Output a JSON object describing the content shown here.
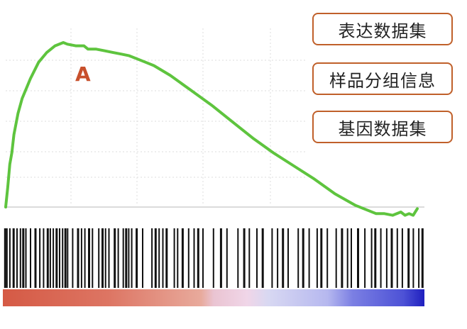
{
  "chart_data": {
    "type": "line",
    "title": "",
    "xlabel": "",
    "ylabel": "",
    "grid": true,
    "annotation": "A",
    "xlim": [
      0,
      100
    ],
    "ylim": [
      -0.05,
      1.0
    ],
    "series": [
      {
        "values_x": [
          0,
          0.5,
          1,
          1.5,
          2,
          3,
          4,
          5,
          6,
          8,
          10,
          12,
          14,
          15,
          17,
          19,
          20,
          22,
          24,
          26,
          28,
          30,
          32,
          34,
          36,
          40,
          45,
          50,
          55,
          60,
          65,
          70,
          75,
          80,
          85,
          90,
          92,
          94,
          96,
          97,
          98,
          99,
          100
        ],
        "values_y": [
          0.0,
          0.12,
          0.26,
          0.33,
          0.44,
          0.57,
          0.66,
          0.72,
          0.78,
          0.88,
          0.94,
          0.98,
          1.0,
          0.99,
          0.98,
          0.98,
          0.96,
          0.96,
          0.95,
          0.94,
          0.93,
          0.92,
          0.9,
          0.88,
          0.86,
          0.8,
          0.71,
          0.62,
          0.52,
          0.42,
          0.33,
          0.25,
          0.17,
          0.08,
          0.01,
          -0.04,
          -0.04,
          -0.05,
          -0.03,
          -0.05,
          -0.04,
          -0.05,
          -0.01
        ]
      }
    ],
    "hits": [
      0.3,
      0.8,
      1.5,
      2.3,
      3.2,
      4.0,
      4.6,
      5.3,
      6.4,
      7.5,
      8.6,
      9.5,
      10.4,
      11.1,
      11.8,
      12.5,
      13.3,
      14.0,
      14.6,
      15.2,
      16.4,
      17.6,
      18.5,
      19.3,
      20.2,
      21.1,
      22.6,
      23.4,
      24.2,
      25.0,
      26.3,
      27.2,
      28.4,
      29.0,
      29.7,
      30.4,
      31.5,
      33.0,
      35.2,
      36.0,
      36.9,
      37.8,
      38.6,
      40.5,
      41.3,
      42.4,
      43.9,
      45.2,
      46.1,
      47.3,
      49.8,
      51.5,
      53.0,
      55.6,
      57.0,
      58.3,
      60.1,
      61.4,
      63.7,
      65.0,
      66.2,
      67.5,
      69.9,
      71.0,
      72.5,
      74.4,
      75.3,
      76.8,
      78.9,
      80.2,
      81.6,
      82.5,
      84.0,
      85.7,
      87.3,
      88.1,
      89.5,
      90.9,
      92.0,
      93.4,
      94.6,
      96.0,
      97.2,
      98.5,
      99.3
    ],
    "colorbar": {
      "gradient": [
        {
          "pos": 0.0,
          "color": "#d55a45"
        },
        {
          "pos": 0.25,
          "color": "#dd7563"
        },
        {
          "pos": 0.47,
          "color": "#e8aa9c"
        },
        {
          "pos": 0.5,
          "color": "#eac4d2"
        },
        {
          "pos": 0.58,
          "color": "#f0d6e8"
        },
        {
          "pos": 0.63,
          "color": "#d8d8f2"
        },
        {
          "pos": 0.77,
          "color": "#b6b8ef"
        },
        {
          "pos": 0.83,
          "color": "#7b7fe3"
        },
        {
          "pos": 0.95,
          "color": "#4d52d6"
        },
        {
          "pos": 1.0,
          "color": "#1f1fbf"
        }
      ]
    }
  },
  "labels": [
    "表达数据集",
    "样品分组信息",
    "基因数据集"
  ],
  "colors": {
    "curve": "#5ec43e",
    "label_border": "#c0602a",
    "annotation": "#c8502c",
    "grid": "#dddddd"
  }
}
